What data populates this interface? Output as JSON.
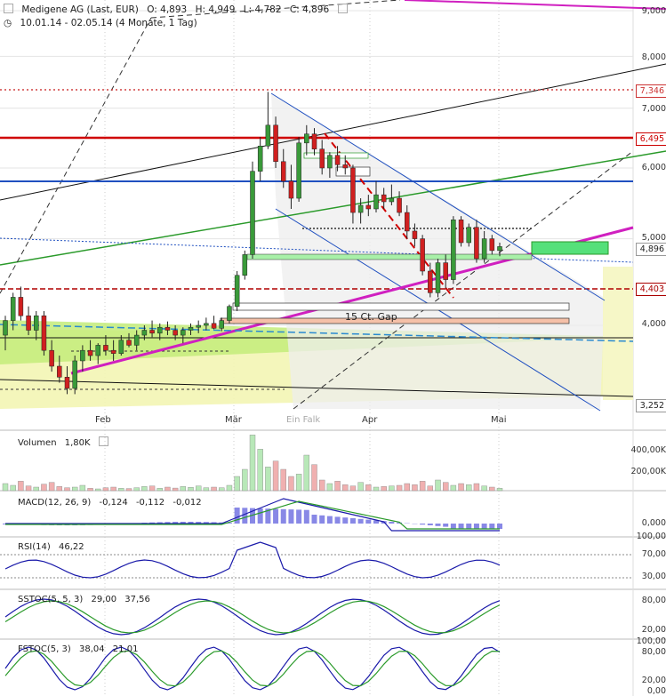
{
  "header": {
    "name": "Medigene AG (Last, EUR)",
    "open": "O: 4,893",
    "high": "H: 4,949",
    "low": "L: 4,782",
    "close": "C: 4,896",
    "range": "10.01.14 - 02.05.14 (4 Monate, 1 Tag)"
  },
  "chart_data": [
    {
      "type": "line",
      "title": "Medigene AG (Last, EUR)",
      "ylim": [
        3.1,
        9.2
      ],
      "y_ticks": [
        "9,000",
        "8,000",
        "7,000",
        "6,000",
        "5,000",
        "4,000"
      ],
      "x_ticks": [
        "Feb",
        "Mär",
        "Apr",
        "Mai"
      ],
      "price_tags": [
        {
          "label": "7,346",
          "value": 7.346,
          "color": "#cc3333"
        },
        {
          "label": "6,495",
          "value": 6.495,
          "color": "#cc0000"
        },
        {
          "label": "4,896",
          "value": 4.896,
          "color": "#333333"
        },
        {
          "label": "4,403",
          "value": 4.403,
          "color": "#aa0000"
        },
        {
          "label": "3,252",
          "value": 3.252,
          "color": "#333333"
        }
      ],
      "annotations": [
        "15 Ct. Gap",
        "Ein Falk"
      ],
      "x": [
        "10.01",
        "13.01",
        "14.01",
        "15.01",
        "16.01",
        "17.01",
        "20.01",
        "21.01",
        "22.01",
        "23.01",
        "24.01",
        "27.01",
        "28.01",
        "29.01",
        "30.01",
        "31.01",
        "03.02",
        "04.02",
        "05.02",
        "06.02",
        "07.02",
        "10.02",
        "11.02",
        "12.02",
        "13.02",
        "14.02",
        "17.02",
        "18.02",
        "19.02",
        "20.02",
        "21.02",
        "24.02",
        "25.02",
        "26.02",
        "27.02",
        "28.02",
        "03.03",
        "04.03",
        "05.03",
        "06.03",
        "07.03",
        "10.03",
        "11.03",
        "12.03",
        "13.03",
        "14.03",
        "17.03",
        "18.03",
        "19.03",
        "20.03",
        "21.03",
        "24.03",
        "25.03",
        "26.03",
        "27.03",
        "28.03",
        "31.03",
        "01.04",
        "02.04",
        "03.04",
        "04.04",
        "07.04",
        "08.04",
        "09.04",
        "10.04",
        "11.04",
        "14.04",
        "15.04",
        "16.04",
        "17.04",
        "22.04",
        "23.04",
        "24.04",
        "25.04",
        "28.04",
        "29.04",
        "30.04",
        "02.05"
      ],
      "series": [
        {
          "name": "Medigene AG",
          "values": [
            [
              3.9,
              4.1,
              3.75,
              4.05
            ],
            [
              4.05,
              4.35,
              3.95,
              4.3
            ],
            [
              4.3,
              4.42,
              4.05,
              4.1
            ],
            [
              4.1,
              4.2,
              3.9,
              3.95
            ],
            [
              3.95,
              4.15,
              3.85,
              4.1
            ],
            [
              4.1,
              4.15,
              3.7,
              3.75
            ],
            [
              3.75,
              3.85,
              3.55,
              3.6
            ],
            [
              3.6,
              3.7,
              3.45,
              3.5
            ],
            [
              3.5,
              3.6,
              3.35,
              3.4
            ],
            [
              3.4,
              3.7,
              3.35,
              3.65
            ],
            [
              3.65,
              3.8,
              3.55,
              3.75
            ],
            [
              3.75,
              3.85,
              3.65,
              3.7
            ],
            [
              3.7,
              3.82,
              3.62,
              3.8
            ],
            [
              3.8,
              3.9,
              3.7,
              3.75
            ],
            [
              3.75,
              3.85,
              3.65,
              3.72
            ],
            [
              3.72,
              3.9,
              3.7,
              3.85
            ],
            [
              3.85,
              3.92,
              3.78,
              3.8
            ],
            [
              3.8,
              3.95,
              3.75,
              3.9
            ],
            [
              3.9,
              4.0,
              3.85,
              3.95
            ],
            [
              3.95,
              4.05,
              3.88,
              3.92
            ],
            [
              3.92,
              4.02,
              3.85,
              3.98
            ],
            [
              3.98,
              4.04,
              3.9,
              3.95
            ],
            [
              3.95,
              4.0,
              3.85,
              3.9
            ],
            [
              3.9,
              3.98,
              3.82,
              3.95
            ],
            [
              3.95,
              4.02,
              3.9,
              3.98
            ],
            [
              3.98,
              4.05,
              3.92,
              4.0
            ],
            [
              4.0,
              4.08,
              3.95,
              4.02
            ],
            [
              4.02,
              4.1,
              3.96,
              3.97
            ],
            [
              3.97,
              4.08,
              3.94,
              4.05
            ],
            [
              4.05,
              4.22,
              4.02,
              4.2
            ],
            [
              4.2,
              4.6,
              4.15,
              4.55
            ],
            [
              4.55,
              4.85,
              4.5,
              4.8
            ],
            [
              4.8,
              6.1,
              4.75,
              5.95
            ],
            [
              5.95,
              6.5,
              5.8,
              6.35
            ],
            [
              6.35,
              7.3,
              6.3,
              6.7
            ],
            [
              6.7,
              6.85,
              6.0,
              6.1
            ],
            [
              6.1,
              6.3,
              5.7,
              5.8
            ],
            [
              5.8,
              6.05,
              5.4,
              5.55
            ],
            [
              5.55,
              6.5,
              5.5,
              6.4
            ],
            [
              6.4,
              6.7,
              6.2,
              6.55
            ],
            [
              6.55,
              6.65,
              6.2,
              6.3
            ],
            [
              6.3,
              6.45,
              5.9,
              6.0
            ],
            [
              6.0,
              6.25,
              5.85,
              6.2
            ],
            [
              6.2,
              6.35,
              5.95,
              6.05
            ],
            [
              6.05,
              6.2,
              5.9,
              6.0
            ],
            [
              6.0,
              6.05,
              5.2,
              5.35
            ],
            [
              5.35,
              5.55,
              5.2,
              5.45
            ],
            [
              5.45,
              5.6,
              5.3,
              5.4
            ],
            [
              5.4,
              5.8,
              5.35,
              5.6
            ],
            [
              5.6,
              5.7,
              5.4,
              5.5
            ],
            [
              5.5,
              5.75,
              5.45,
              5.55
            ],
            [
              5.55,
              5.65,
              5.3,
              5.35
            ],
            [
              5.35,
              5.45,
              5.0,
              5.1
            ],
            [
              5.1,
              5.2,
              4.9,
              5.0
            ],
            [
              5.0,
              5.05,
              4.55,
              4.6
            ],
            [
              4.6,
              4.7,
              4.3,
              4.35
            ],
            [
              4.35,
              4.75,
              4.3,
              4.7
            ],
            [
              4.7,
              4.8,
              4.4,
              4.5
            ],
            [
              4.5,
              5.3,
              4.45,
              5.25
            ],
            [
              5.25,
              5.3,
              4.9,
              4.95
            ],
            [
              4.95,
              5.2,
              4.9,
              5.15
            ],
            [
              5.15,
              5.25,
              4.7,
              4.75
            ],
            [
              4.75,
              5.1,
              4.7,
              5.0
            ],
            [
              5.0,
              5.05,
              4.8,
              4.85
            ],
            [
              4.85,
              4.95,
              4.78,
              4.9
            ]
          ]
        },
        {
          "name": "Resistance (thick red)",
          "value": 6.495
        },
        {
          "name": "Blue line",
          "value": 5.78
        },
        {
          "name": "Red dashed",
          "value": 4.403
        },
        {
          "name": "Dotted",
          "value": 5.2
        }
      ]
    },
    {
      "type": "bar",
      "title": "Volumen",
      "label": "Volumen",
      "value_text": "1,80K",
      "y_ticks": [
        "400,00K",
        "200,00K"
      ],
      "ylim": [
        0,
        480000
      ],
      "values": [
        60000,
        45000,
        80000,
        40000,
        30000,
        55000,
        70000,
        35000,
        25000,
        30000,
        45000,
        20000,
        15000,
        25000,
        30000,
        20000,
        18000,
        25000,
        35000,
        40000,
        20000,
        30000,
        22000,
        35000,
        28000,
        40000,
        25000,
        30000,
        25000,
        45000,
        120000,
        180000,
        470000,
        350000,
        200000,
        250000,
        180000,
        120000,
        140000,
        300000,
        220000,
        90000,
        60000,
        80000,
        50000,
        40000,
        70000,
        50000,
        30000,
        35000,
        40000,
        45000,
        60000,
        50000,
        80000,
        40000,
        90000,
        70000,
        45000,
        60000,
        50000,
        60000,
        40000,
        30000,
        20000,
        40000,
        30000,
        15000,
        10000,
        8000,
        5000,
        3000
      ]
    },
    {
      "type": "line",
      "title": "MACD(12, 26, 9)",
      "label": "MACD(12, 26, 9)",
      "values_text": [
        "-0,124",
        "-0,112",
        "-0,012"
      ],
      "y_ticks": [
        "0,000"
      ]
    },
    {
      "type": "line",
      "title": "RSI(14)",
      "label": "RSI(14)",
      "value_text": "46,22",
      "y_ticks": [
        "100,00",
        "70,00",
        "30,00"
      ]
    },
    {
      "type": "line",
      "title": "SSTOC(5, 5, 3)",
      "label": "SSTOC(5, 5, 3)",
      "values_text": [
        "29,00",
        "37,56"
      ],
      "y_ticks": [
        "80,00",
        "20,00"
      ]
    },
    {
      "type": "line",
      "title": "FSTOC(5, 3)",
      "label": "FSTOC(5, 3)",
      "values_text": [
        "38,04",
        "21,01"
      ],
      "y_ticks": [
        "100,00",
        "80,00",
        "20,00",
        "0,00"
      ]
    }
  ],
  "colors": {
    "up": "#3a9a3a",
    "down": "#d02020",
    "trend_magenta": "#d020c0",
    "trend_green": "#2a9a2a",
    "trend_blue": "#2050c0"
  }
}
